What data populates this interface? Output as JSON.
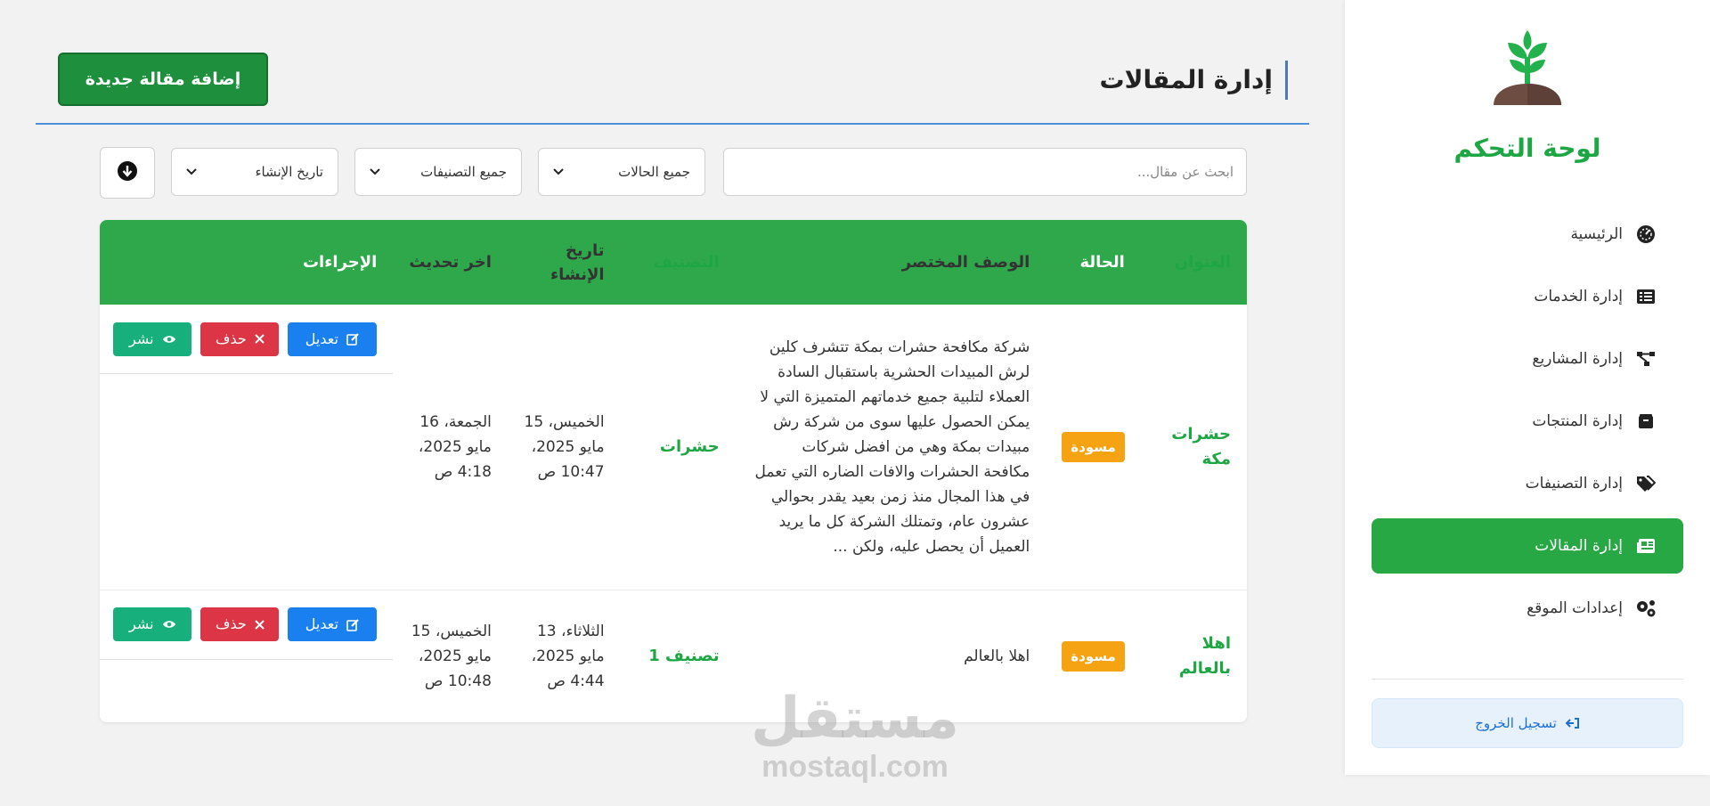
{
  "sidebar": {
    "brand": "لوحة التحكم",
    "items": [
      {
        "label": "الرئيسية",
        "icon": "dashboard-gauge-icon"
      },
      {
        "label": "إدارة الخدمات",
        "icon": "list-icon"
      },
      {
        "label": "إدارة المشاريع",
        "icon": "project-diagram-icon"
      },
      {
        "label": "إدارة المنتجات",
        "icon": "box-icon"
      },
      {
        "label": "إدارة التصنيفات",
        "icon": "tags-icon"
      },
      {
        "label": "إدارة المقالات",
        "icon": "newspaper-icon",
        "active": true
      },
      {
        "label": "إعدادات الموقع",
        "icon": "gears-icon"
      }
    ],
    "logout": "تسجيل الخروج"
  },
  "header": {
    "title": "إدارة المقالات",
    "add_button": "إضافة مقالة جديدة"
  },
  "filters": {
    "search_placeholder": "ابحث عن مقال...",
    "status": "جميع الحالات",
    "categories": "جميع التصنيفات",
    "sort": "تاريخ الإنشاء"
  },
  "table": {
    "columns": [
      "العنوان",
      "الحالة",
      "الوصف المختصر",
      "التصنيف",
      "تاريخ الإنشاء",
      "اخر تحديث",
      "الإجراءات"
    ],
    "rows": [
      {
        "title": "حشرات مكة",
        "status": "مسودة",
        "description": "شركة مكافحة حشرات بمكة تتشرف كلين لرش المبيدات الحشرية باستقبال السادة العملاء لتلبية جميع خدماتهم المتميزة التي لا يمكن الحصول عليها سوى من شركة رش مبيدات بمكة وهي من افضل شركات مكافحة الحشرات والافات الضاره التي تعمل في هذا المجال منذ زمن بعيد يقدر بحوالي عشرون عام، وتمتلك الشركة كل ما يريد العميل أن يحصل عليه، ولكن ...",
        "category": "حشرات",
        "created": "الخميس، 15 مايو 2025، 10:47 ص",
        "updated": "الجمعة، 16 مايو 2025، 4:18 ص"
      },
      {
        "title": "اهلا بالعالم",
        "status": "مسودة",
        "description": "اهلا بالعالم",
        "category": "تصنيف 1",
        "created": "الثلاثاء، 13 مايو 2025، 4:44 ص",
        "updated": "الخميس، 15 مايو 2025، 10:48 ص"
      }
    ],
    "actions": {
      "edit": "تعديل",
      "delete": "حذف",
      "publish": "نشر"
    }
  },
  "watermark": {
    "arabic": "مستقل",
    "latin": "mostaql.com"
  },
  "colors": {
    "primary_green": "#28a745",
    "header_green": "#2ea84a",
    "edit_blue": "#1a80f0",
    "delete_red": "#dc3545",
    "publish_teal": "#17b07c",
    "draft_orange": "#f6a313"
  }
}
